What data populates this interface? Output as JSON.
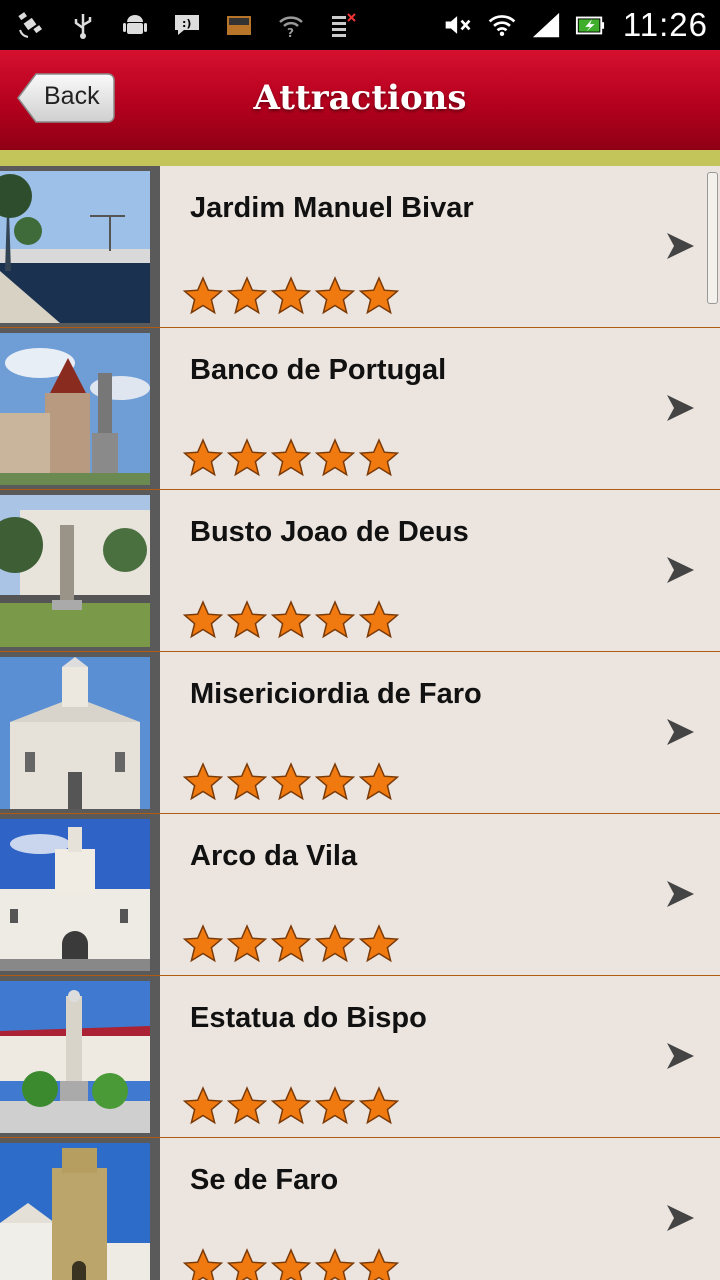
{
  "status_bar": {
    "time": "11:26",
    "left_icons": [
      "satellite-icon",
      "usb-icon",
      "android-icon",
      "chat-icon",
      "amazon-icon",
      "wifi-question-icon",
      "task-icon"
    ],
    "right_icons": [
      "mute-icon",
      "wifi-icon",
      "signal-icon",
      "battery-icon"
    ]
  },
  "header": {
    "back_label": "Back",
    "title": "Attractions"
  },
  "attractions": [
    {
      "name": "Jardim Manuel Bivar",
      "rating": 5
    },
    {
      "name": "Banco de Portugal",
      "rating": 5
    },
    {
      "name": "Busto Joao de Deus",
      "rating": 5
    },
    {
      "name": "Misericiordia de Faro",
      "rating": 5
    },
    {
      "name": "Arco da Vila",
      "rating": 5
    },
    {
      "name": "Estatua do Bispo",
      "rating": 5
    },
    {
      "name": "Se de Faro",
      "rating": 5
    }
  ],
  "colors": {
    "header_red": "#c1001f",
    "accent_strip": "#c3c45a",
    "list_bg": "#ece5df",
    "separator": "#b15a12",
    "star_orange": "#f07a10"
  }
}
